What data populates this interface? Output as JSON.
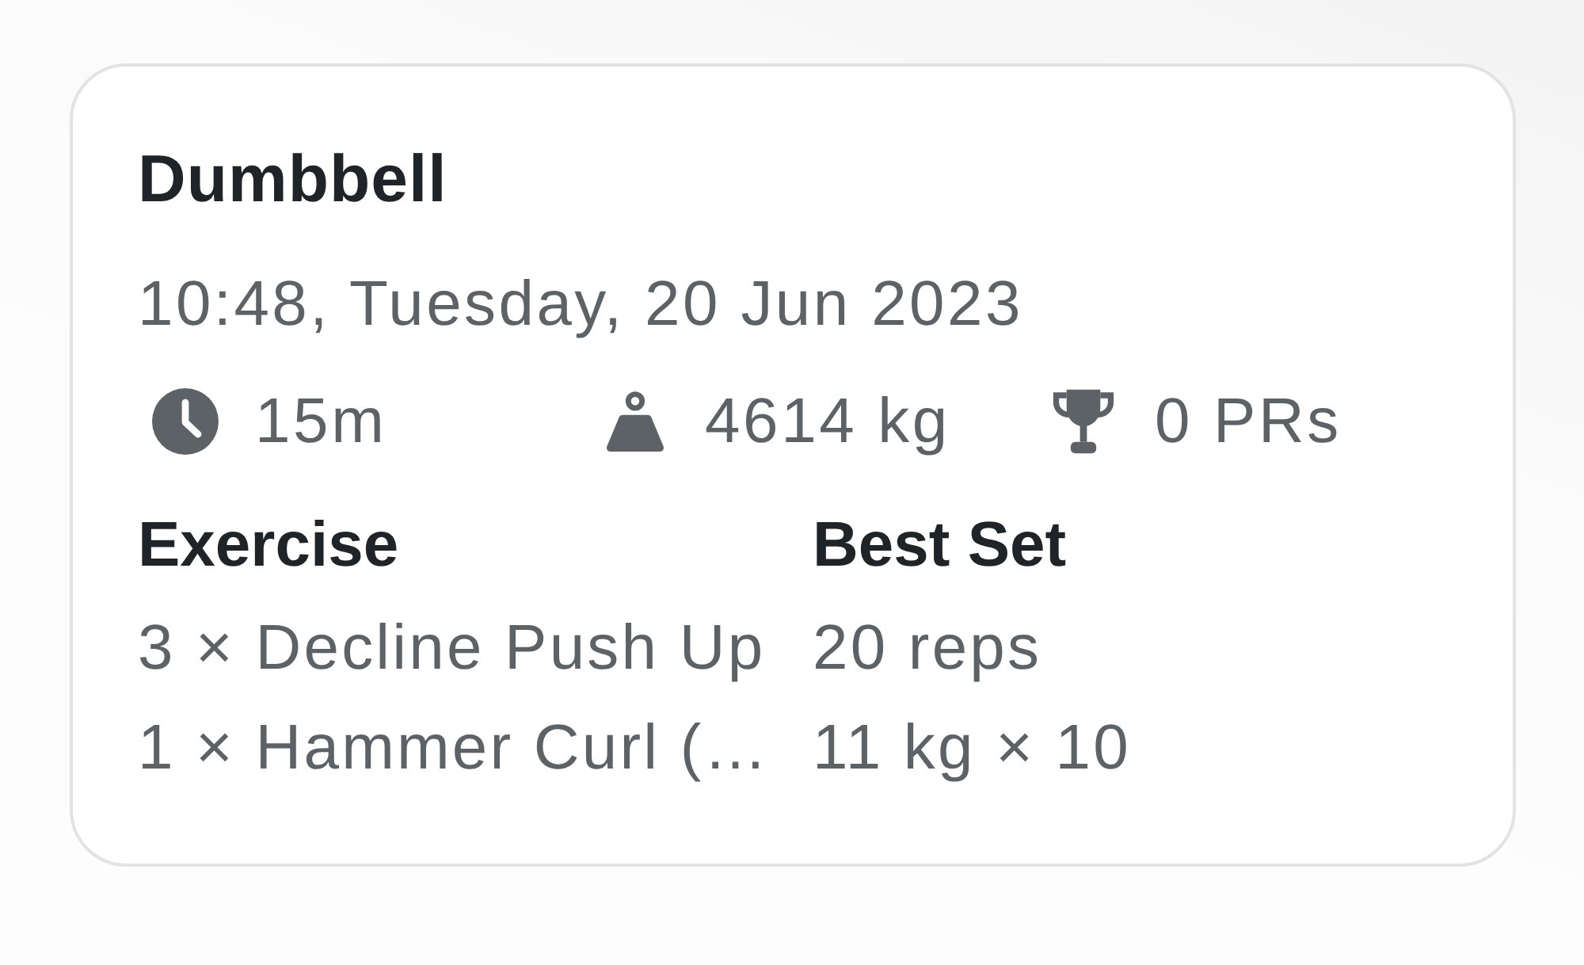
{
  "workout": {
    "title": "Dumbbell",
    "date": "10:48, Tuesday, 20 Jun 2023",
    "stats": [
      {
        "kind": "duration",
        "value": "15m"
      },
      {
        "kind": "volume",
        "value": "4614 kg"
      },
      {
        "kind": "prs",
        "value": "0 PRs"
      }
    ],
    "table": {
      "columns": [
        "Exercise",
        "Best Set"
      ],
      "rows": [
        [
          "3 × Decline Push Up",
          "20 reps"
        ],
        [
          "1 × Hammer Curl (…",
          "11 kg × 10"
        ]
      ]
    }
  }
}
